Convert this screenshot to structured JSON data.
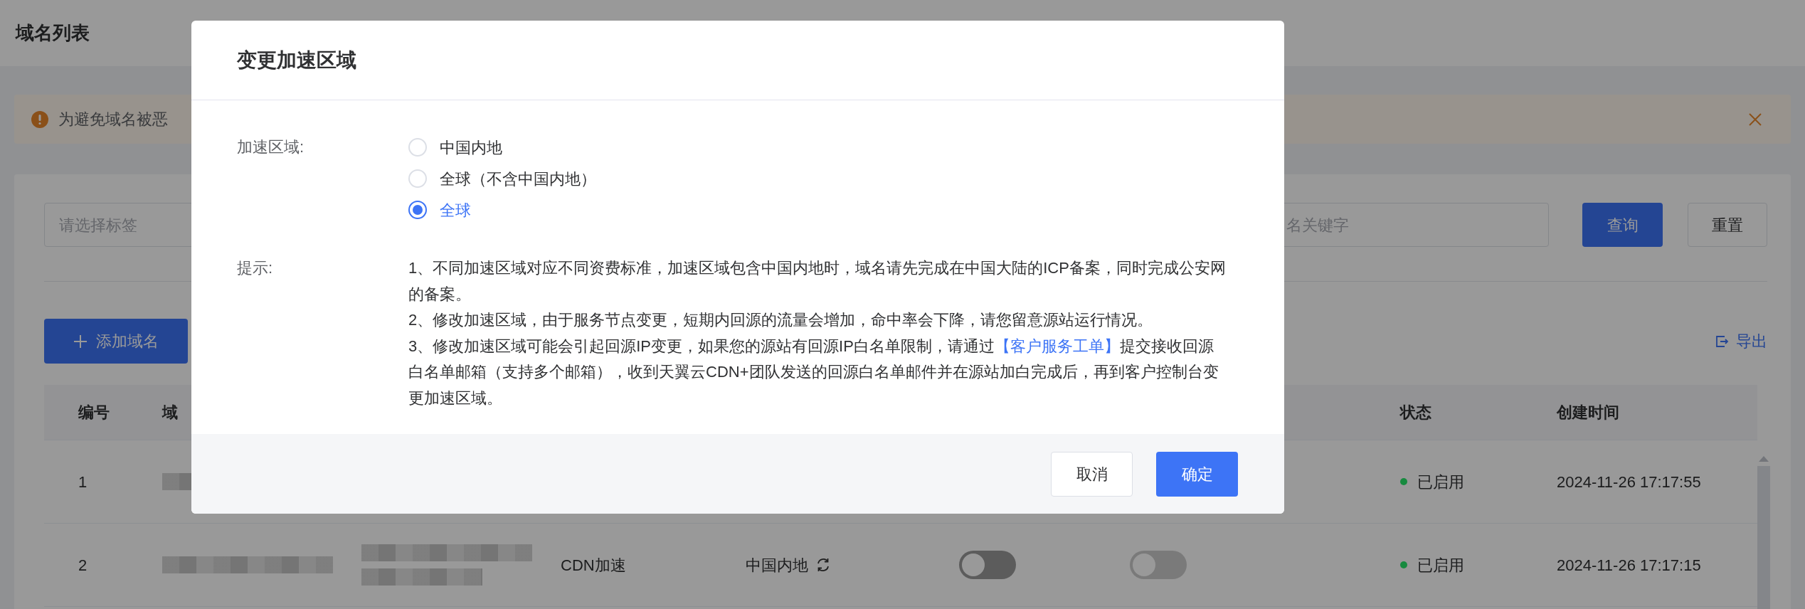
{
  "page": {
    "title": "域名列表"
  },
  "alert": {
    "text": "为避免域名被恶"
  },
  "filters": {
    "tag_placeholder": "请选择标签",
    "keyword_placeholder": "名关键字",
    "buttons": [
      {
        "label": "查询",
        "kind": "primary"
      },
      {
        "label": "重置",
        "kind": "default"
      }
    ]
  },
  "toolbar": {
    "add_button": "添加域名",
    "export_link": "导出"
  },
  "table": {
    "columns": [
      {
        "label": "编号"
      },
      {
        "label": "域"
      },
      {
        "label": "状态"
      },
      {
        "label": "创建时间"
      }
    ],
    "rows": [
      {
        "number": "1",
        "domain_redacted": true,
        "status": "已启用",
        "color": "#178a3f",
        "created": "2024-11-26 17:17:55"
      },
      {
        "number": "2",
        "domain_redacted": true,
        "source_redacted": true,
        "type": "CDN加速",
        "region": "中国内地",
        "switches": [
          {
            "on": false,
            "disabled": false
          },
          {
            "on": false,
            "disabled": true
          }
        ],
        "status": "已启用",
        "color": "#178a3f",
        "created": "2024-11-26 17:17:15"
      }
    ]
  },
  "dialog": {
    "title": "变更加速区域",
    "region_label": "加速区域:",
    "options": [
      {
        "label": "中国内地",
        "selected": false
      },
      {
        "label": "全球（不含中国内地）",
        "selected": false
      },
      {
        "label": "全球",
        "selected": true
      }
    ],
    "tip_label": "提示:",
    "tips": [
      {
        "text": "1、不同加速区域对应不同资费标准，加速区域包含中国内地时，域名请先完成在中国大陆的ICP备案，同时完成公安网的备案。"
      },
      {
        "text": "2、修改加速区域，由于服务节点变更，短期内回源的流量会增加，命中率会下降，请您留意源站运行情况。"
      },
      {
        "text": "3、修改加速区域可能会引起回源IP变更，如果您的源站有回源IP白名单限制，请通过",
        "link": "【客户服务工单】",
        "after": "提交接收回源白名单邮箱（支持多个邮箱），收到天翼云CDN+团队发送的回源白名单邮件并在源站加白完成后，再到客户控制台变更加速区域。"
      }
    ],
    "buttons": [
      {
        "label": "取消",
        "kind": "default"
      },
      {
        "label": "确定",
        "kind": "primary"
      }
    ]
  }
}
